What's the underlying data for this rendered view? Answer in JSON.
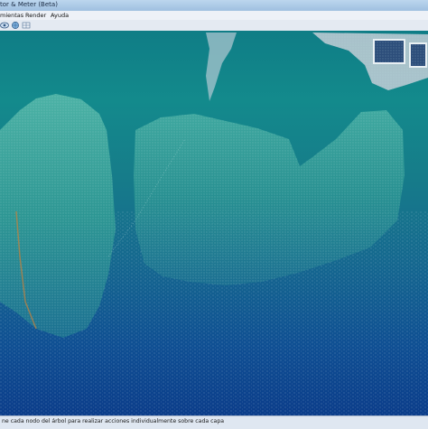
{
  "window": {
    "title": "tor & Meter (Beta)"
  },
  "menu": {
    "items": [
      "mientas",
      "Render",
      "Ayuda"
    ]
  },
  "toolbar": {
    "icons": [
      "view-icon",
      "globe-icon",
      "grid-icon"
    ]
  },
  "status": {
    "text": "ne cada nodo del árbol para realizar acciones individualmente sobre cada capa"
  },
  "colors": {
    "viewport_top": "#0f7d86",
    "viewport_bottom": "#0b3d8a",
    "rock": "#3fa79d",
    "points": "#d8e6ef"
  }
}
